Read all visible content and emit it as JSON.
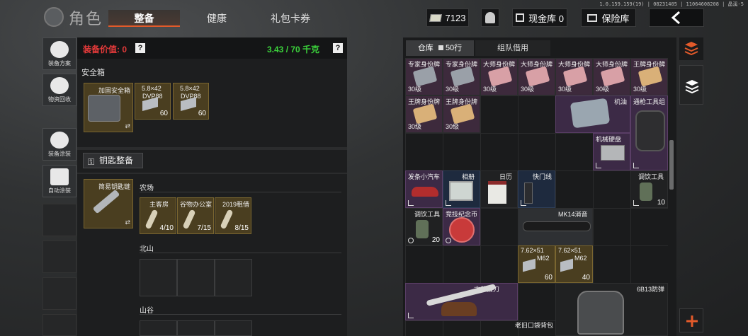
{
  "header": {
    "title": "角色",
    "tabs": [
      "整备",
      "健康",
      "礼包卡券"
    ],
    "money": "7123",
    "cash_storage": "现金库 0",
    "vault": "保险库",
    "version": "1.0.159.159(19) | 08231405 | 11064608208 | 晶溪-5"
  },
  "left_nav": [
    "装备方案",
    "物资回收",
    "装备涂装",
    "自动涂装"
  ],
  "equip": {
    "value_label": "装备价值: 0",
    "weight": "3.43 / 70 千克",
    "safebox_section": "安全箱",
    "safebox_item": "加固安全箱",
    "ammo1": {
      "name": "5.8×42",
      "sub": "DVP88",
      "count": "60"
    },
    "ammo2": {
      "name": "5.8×42",
      "sub": "DVP88",
      "count": "60"
    },
    "key_button": "钥匙整备",
    "keychain": "简易钥匙链",
    "area1": "农场",
    "keys": [
      {
        "name": "主客房",
        "count": "4/10"
      },
      {
        "name": "谷物办公室",
        "count": "7/15"
      },
      {
        "name": "2019租借",
        "count": "8/15"
      }
    ],
    "area2": "北山",
    "area3": "山谷"
  },
  "inventory": {
    "tab_warehouse": "仓库",
    "tab_count": "50行",
    "tab_team": "组队借用",
    "row1": [
      {
        "name": "专家身份牌",
        "level": "30级"
      },
      {
        "name": "专家身份牌",
        "level": "30级"
      },
      {
        "name": "大师身份牌",
        "level": "30级"
      },
      {
        "name": "大师身份牌",
        "level": "30级"
      },
      {
        "name": "大师身份牌",
        "level": "30级"
      },
      {
        "name": "大师身份牌",
        "level": "30级"
      },
      {
        "name": "王牌身份牌",
        "level": "30级"
      }
    ],
    "row2": [
      {
        "name": "王牌身份牌",
        "level": "30级"
      },
      {
        "name": "王牌身份牌",
        "level": "30级"
      }
    ],
    "oil": "机油",
    "gun_kit": "通枪工具组",
    "hdd": "机械硬盘",
    "car": "发条小汽车",
    "photo": "相册",
    "calendar": "日历",
    "usb": "快门线",
    "cook1": {
      "name": "调饮工具",
      "count": "10"
    },
    "cook2": {
      "name": "调饮工具",
      "count": "20"
    },
    "coin": "竞技纪念币",
    "silencer": "MK14消音",
    "ammo762a": {
      "name": "7.62×51",
      "sub": "M62",
      "count": "60"
    },
    "ammo762b": {
      "name": "7.62×51",
      "sub": "M62",
      "count": "40"
    },
    "knife": "古董猎刀",
    "vest": "6B13防弹",
    "bag": "老旧口袋背包"
  },
  "colors": {
    "accent": "#e35a2a",
    "value_green": "#3bd23b",
    "value_red": "#e43a3a"
  }
}
